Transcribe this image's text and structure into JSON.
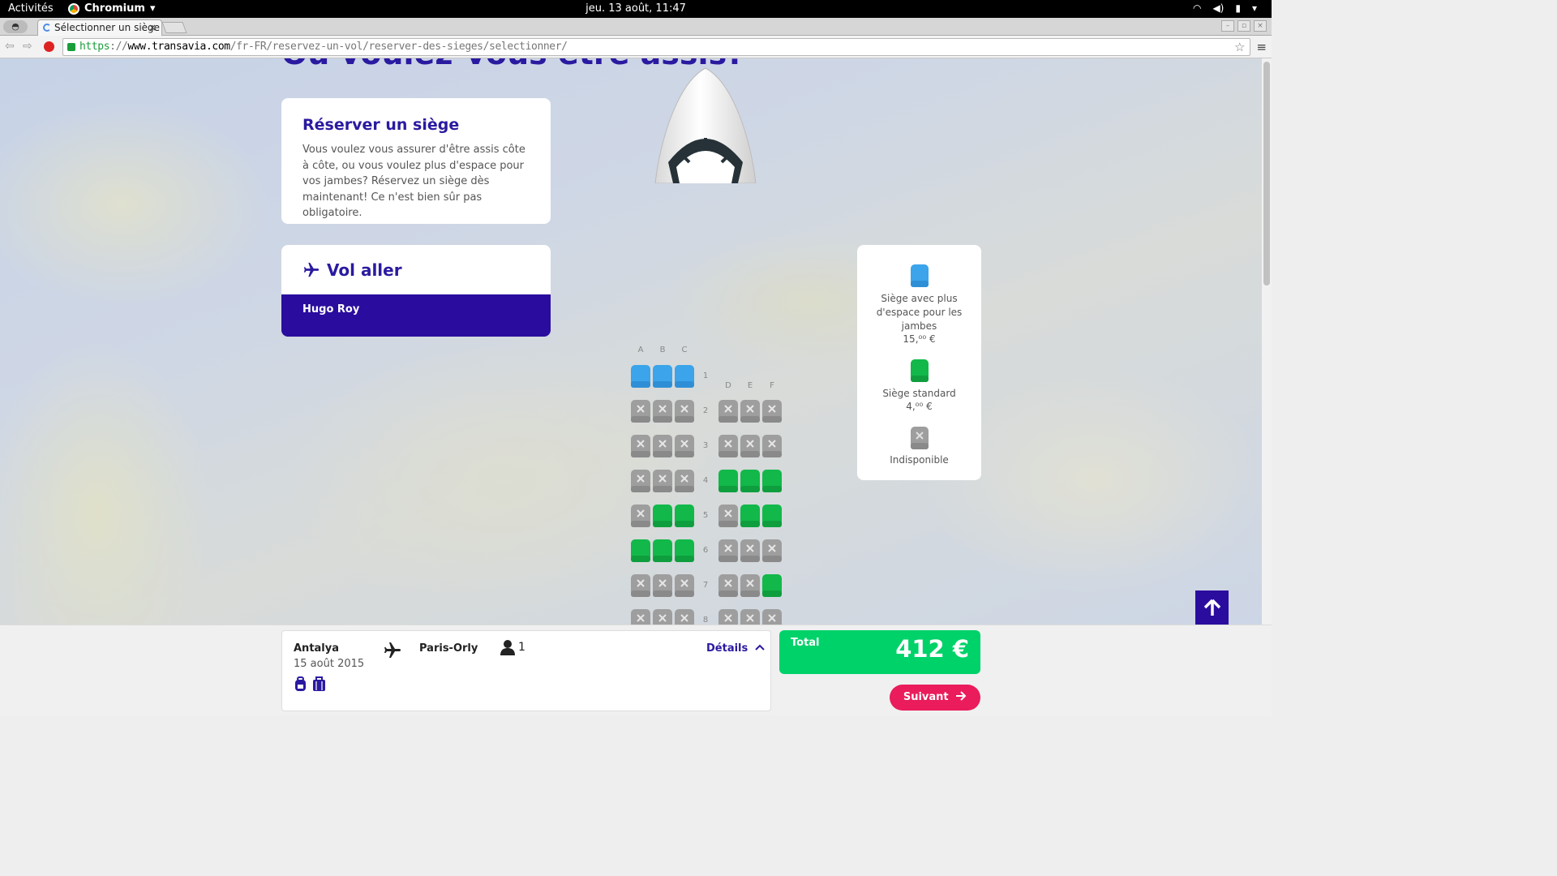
{
  "system": {
    "activities": "Activités",
    "app_name": "Chromium",
    "clock": "jeu. 13 août, 11:47"
  },
  "browser": {
    "tab_title": "Sélectionner un siège",
    "tab_close": "×",
    "url_scheme": "https",
    "url_separator": "://",
    "url_host": "www.transavia.com",
    "url_path": "/fr-FR/reservez-un-vol/reserver-des-sieges/selectionner/"
  },
  "page": {
    "title": "Où voulez-vous être assis?",
    "reserve_heading": "Réserver un siège",
    "reserve_text": "Vous voulez vous assurer d'être assis côte à côte, ou vous voulez plus d'espace pour vos jambes? Réservez un siège dès maintenant! Ce n'est bien sûr pas obligatoire.",
    "flight_heading": "Vol aller",
    "passenger": "Hugo Roy"
  },
  "legend": {
    "extra_label": "Siège avec plus d'espace pour les jambes",
    "extra_price": "15,⁰⁰ €",
    "standard_label": "Siège standard",
    "standard_price": "4,⁰⁰ €",
    "unavailable_label": "Indisponible"
  },
  "seatmap": {
    "columns_left": [
      "A",
      "B",
      "C"
    ],
    "columns_right": [
      "D",
      "E",
      "F"
    ],
    "rows": [
      {
        "num": "1",
        "left": [
          "extra",
          "extra",
          "extra"
        ],
        "right": []
      },
      {
        "num": "2",
        "left": [
          "unavailable",
          "unavailable",
          "unavailable"
        ],
        "right": [
          "unavailable",
          "unavailable",
          "unavailable"
        ]
      },
      {
        "num": "3",
        "left": [
          "unavailable",
          "unavailable",
          "unavailable"
        ],
        "right": [
          "unavailable",
          "unavailable",
          "unavailable"
        ]
      },
      {
        "num": "4",
        "left": [
          "unavailable",
          "unavailable",
          "unavailable"
        ],
        "right": [
          "standard",
          "standard",
          "standard"
        ]
      },
      {
        "num": "5",
        "left": [
          "unavailable",
          "standard",
          "standard"
        ],
        "right": [
          "unavailable",
          "standard",
          "standard"
        ]
      },
      {
        "num": "6",
        "left": [
          "standard",
          "standard",
          "standard"
        ],
        "right": [
          "unavailable",
          "unavailable",
          "unavailable"
        ]
      },
      {
        "num": "7",
        "left": [
          "unavailable",
          "unavailable",
          "unavailable"
        ],
        "right": [
          "unavailable",
          "unavailable",
          "standard"
        ]
      },
      {
        "num": "8",
        "left": [
          "unavailable",
          "unavailable",
          "unavailable"
        ],
        "right": [
          "unavailable",
          "unavailable",
          "unavailable"
        ]
      }
    ]
  },
  "summary": {
    "origin": "Antalya",
    "date": "15 août 2015",
    "destination": "Paris-Orly",
    "passengers": "1",
    "details": "Détails",
    "total_label": "Total",
    "total_amount": "412 €",
    "next": "Suivant"
  },
  "colors": {
    "brand": "#2a1aa0",
    "extra_seat": "#3ba4ea",
    "standard_seat": "#12b84a",
    "unavailable_seat": "#9e9e9e",
    "total_green": "#00d26a",
    "next_pink": "#ea1c5b"
  },
  "icons": {
    "plane": "plane-icon",
    "person": "person-icon",
    "arrow_up": "arrow-up-icon",
    "arrow_right": "arrow-right-icon",
    "chevron_up": "chevron-up-icon"
  }
}
